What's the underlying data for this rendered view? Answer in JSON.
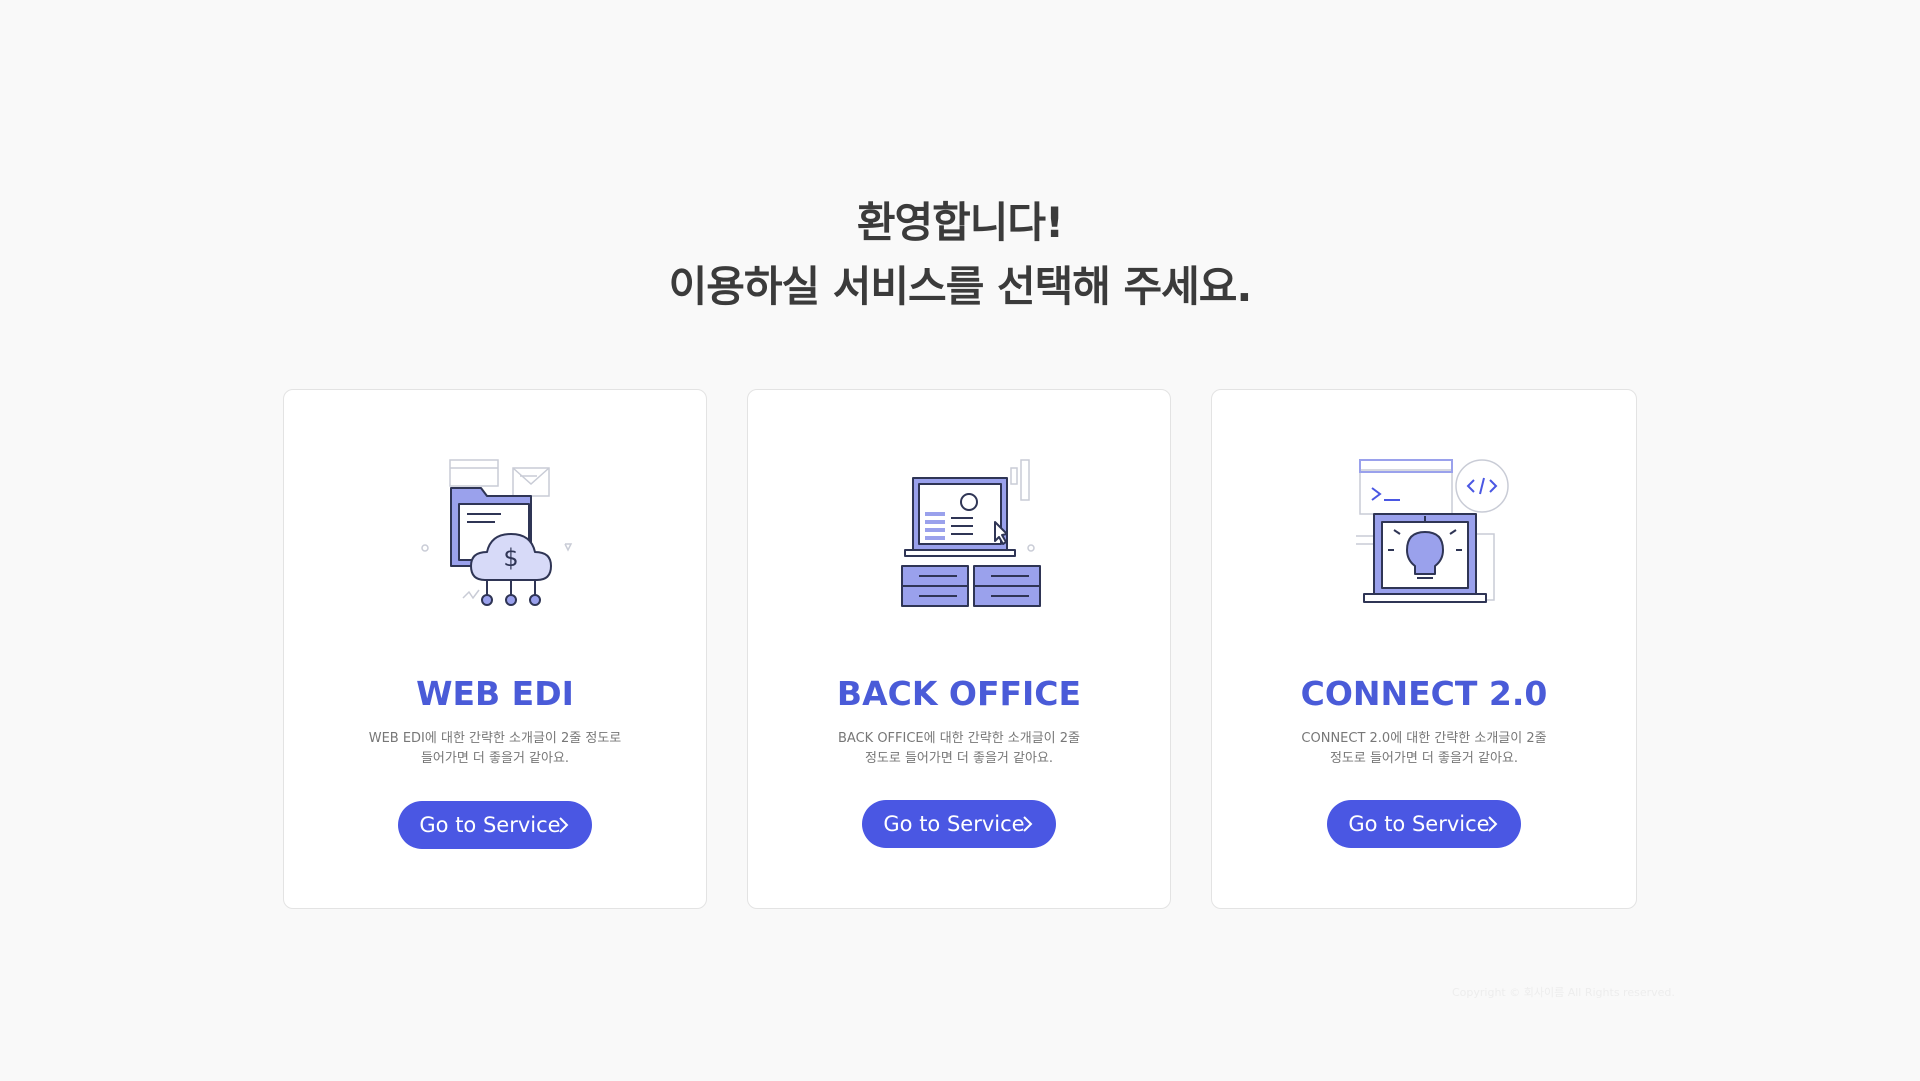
{
  "welcome": {
    "line1": "환영합니다!",
    "line2": "이용하실 서비스를 선택해 주세요."
  },
  "cards": [
    {
      "title": "WEB EDI",
      "desc_line1": "WEB EDI에 대한 간략한 소개글이 2줄 정도로",
      "desc_line2": "들어가면 더 좋을거 같아요.",
      "button_label": "Go to Service"
    },
    {
      "title": "BACK OFFICE",
      "desc_line1": "BACK OFFICE에 대한 간략한 소개글이 2줄",
      "desc_line2": "정도로 들어가면 더 좋을거 같아요.",
      "button_label": "Go to Service"
    },
    {
      "title": "CONNECT 2.0",
      "desc_line1": "CONNECT 2.0에 대한 간략한 소개글이 2줄",
      "desc_line2": "정도로 들어가면 더 좋을거 같아요.",
      "button_label": "Go to Service"
    }
  ],
  "footer": {
    "copyright": "Copyright © 회사이름 All Rights reserved."
  },
  "colors": {
    "accent": "#4a57e3",
    "title": "#4a5bd8",
    "illustration_fill": "#9aa1ec",
    "illustration_stroke": "#2f3555",
    "background": "#f9f9f9"
  }
}
